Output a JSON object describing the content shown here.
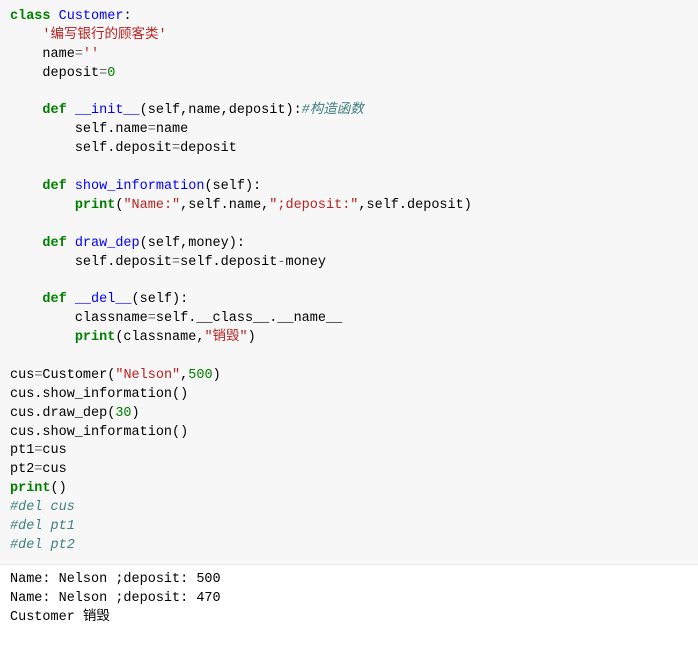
{
  "code": {
    "kw_class": "class",
    "cls_name": "Customer",
    "colon": ":",
    "docstring": "'编写银行的顾客类'",
    "name_assign_l": "name",
    "eq": "=",
    "name_assign_r": "''",
    "deposit_assign_l": "deposit",
    "deposit_assign_r": "0",
    "kw_def": "def",
    "init_name": "__init__",
    "init_params": "(self,name,deposit):",
    "init_cmt": "#构造函数",
    "init_body1": "self.name",
    "init_body1_r": "name",
    "init_body2": "self.deposit",
    "init_body2_r": "deposit",
    "show_name": "show_information",
    "show_params": "(self):",
    "kw_print": "print",
    "show_arg1": "\"Name:\"",
    "show_mid": ",self.name,",
    "show_arg2": "\";deposit:\"",
    "show_tail": ",self.deposit)",
    "draw_name": "draw_dep",
    "draw_params": "(self,money):",
    "draw_body_l": "self.deposit",
    "draw_body_r1": "self.deposit",
    "draw_minus": "-",
    "draw_body_r2": "money",
    "del_name": "__del__",
    "del_params": "(self):",
    "del_body1_l": "classname",
    "del_body1_r": "self.__class__.__name__",
    "del_print_tail": "(classname,",
    "del_str": "\"销毁\"",
    "del_close": ")",
    "inst_l": "cus",
    "inst_r1": "Customer(",
    "inst_str": "\"Nelson\"",
    "inst_comma": ",",
    "inst_num": "500",
    "inst_close": ")",
    "call1": "cus.show_information()",
    "call2_pre": "cus.draw_dep(",
    "call2_num": "30",
    "call2_post": ")",
    "call3": "cus.show_information()",
    "pt1_l": "pt1",
    "pt1_r": "cus",
    "pt2_l": "pt2",
    "pt2_r": "cus",
    "print_empty": "()",
    "cmt1": "#del cus",
    "cmt2": "#del pt1",
    "cmt3": "#del pt2"
  },
  "output": {
    "line1": "Name: Nelson ;deposit: 500",
    "line2": "Name: Nelson ;deposit: 470",
    "line3": "Customer 销毁"
  }
}
